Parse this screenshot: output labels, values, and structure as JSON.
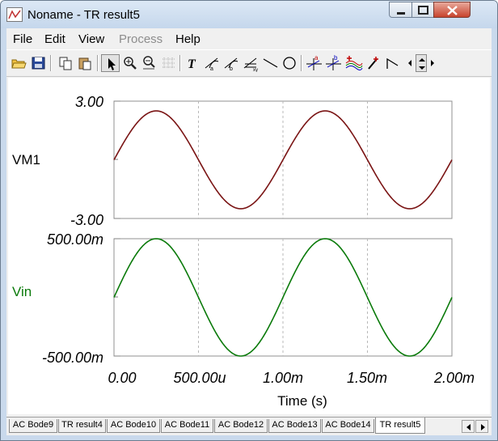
{
  "window": {
    "title": "Noname - TR result5"
  },
  "menu": {
    "items": [
      {
        "label": "File",
        "enabled": true
      },
      {
        "label": "Edit",
        "enabled": true
      },
      {
        "label": "View",
        "enabled": true
      },
      {
        "label": "Process",
        "enabled": false
      },
      {
        "label": "Help",
        "enabled": true
      }
    ]
  },
  "toolbar": {
    "buttons": [
      "open-icon",
      "save-icon",
      "copy-icon",
      "paste-icon",
      "pointer-icon",
      "zoom-in-icon",
      "zoom-100-icon",
      "grid-icon",
      "text-icon",
      "cursor-a-icon",
      "cursor-b-icon",
      "axis-icon",
      "line-icon",
      "circle-icon",
      "cursor-a-cross-icon",
      "cursor-b-cross-icon",
      "curves-icon",
      "pen-icon",
      "marker-icon",
      "scroll-left-icon",
      "scroll-up-down-icon",
      "scroll-right-icon"
    ],
    "pressed": "pointer-icon"
  },
  "chart_data": [
    {
      "type": "line",
      "series": [
        {
          "name": "VM1",
          "color": "#7a1414"
        }
      ],
      "ylabel": "VM1",
      "y_ticks": [
        "3.00",
        "-3.00"
      ],
      "ylim": [
        -3,
        3
      ],
      "amplitude": 2.5,
      "frequency_hz": 1000,
      "x_range_ms": [
        0,
        2
      ],
      "grid": "vertical dashed"
    },
    {
      "type": "line",
      "series": [
        {
          "name": "Vin",
          "color": "#0a7a0a"
        }
      ],
      "ylabel": "Vin",
      "y_ticks": [
        "500.00m",
        "-500.00m"
      ],
      "ylim": [
        -0.5,
        0.5
      ],
      "amplitude": 0.5,
      "frequency_hz": 1000,
      "x_range_ms": [
        0,
        2
      ],
      "grid": "vertical dashed"
    }
  ],
  "xaxis": {
    "ticks": [
      "0.00",
      "500.00u",
      "1.00m",
      "1.50m",
      "2.00m"
    ],
    "label": "Time (s)"
  },
  "tabs": {
    "items": [
      "AC Bode9",
      "TR result4",
      "AC Bode10",
      "AC Bode11",
      "AC Bode12",
      "AC Bode13",
      "AC Bode14",
      "TR result5"
    ],
    "active": 7
  }
}
